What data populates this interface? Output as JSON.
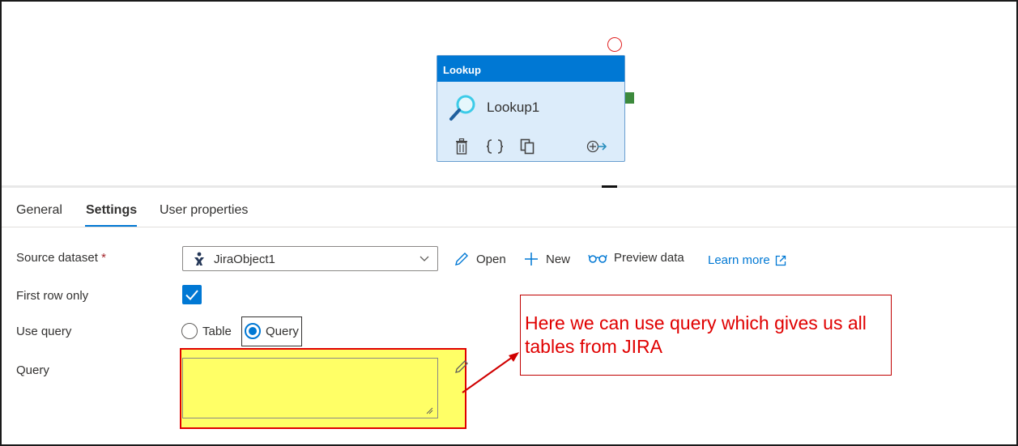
{
  "activity": {
    "type_label": "Lookup",
    "name": "Lookup1",
    "icon": "magnifier-icon",
    "actions": [
      "delete-icon",
      "code-braces-icon",
      "copy-icon",
      "add-output-icon"
    ]
  },
  "tabs": [
    {
      "label": "General",
      "active": false
    },
    {
      "label": "Settings",
      "active": true
    },
    {
      "label": "User properties",
      "active": false
    }
  ],
  "form": {
    "source_dataset": {
      "label": "Source dataset",
      "required_marker": "*",
      "value": "JiraObject1",
      "icon": "jira-icon"
    },
    "toolbar": {
      "open": "Open",
      "new": "New",
      "preview": "Preview data",
      "learn_more": "Learn more"
    },
    "first_row_only": {
      "label": "First row only",
      "checked": true
    },
    "use_query": {
      "label": "Use query",
      "options": [
        "Table",
        "Query"
      ],
      "selected": "Query"
    },
    "query": {
      "label": "Query",
      "value": ""
    }
  },
  "annotation": {
    "text": "Here we can use query which gives us all tables from JIRA"
  },
  "colors": {
    "accent": "#0078d4",
    "annotation_red": "#e00000",
    "highlight_yellow": "#ffff66",
    "success_green": "#3d8a3d"
  }
}
